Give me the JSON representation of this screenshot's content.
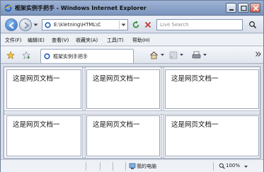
{
  "window": {
    "title": "框架实例手把手 - Windows Internet Explorer"
  },
  "address": {
    "value": "E:\\kletning\\HTML\\C",
    "search_placeholder": "Live Search"
  },
  "menu": {
    "items": [
      "文件(F)",
      "编辑(E)",
      "查看(V)",
      "收藏夹(A)",
      "工具(T)",
      "帮助(H)"
    ]
  },
  "tab": {
    "label": "框架实例手把手"
  },
  "frames": {
    "cells": [
      "这是网页文档一",
      "这是网页文档一",
      "这是网页文档一",
      "这是网页文档一",
      "这是网页文档一",
      "这是网页文档一"
    ]
  },
  "status": {
    "zone": "我的电脑",
    "zoom": "100%"
  },
  "colors": {
    "title_bar": "#7a94bd",
    "frame_border": "#9aa4b6",
    "content_bg": "#ffffff"
  },
  "icons": [
    "ie-logo-icon",
    "minimize-icon",
    "maximize-icon",
    "close-icon",
    "back-icon",
    "forward-icon",
    "refresh-icon",
    "stop-icon",
    "search-icon",
    "favorites-star-icon",
    "add-favorites-icon",
    "home-icon",
    "feeds-icon",
    "print-icon",
    "computer-icon",
    "zoom-icon"
  ]
}
